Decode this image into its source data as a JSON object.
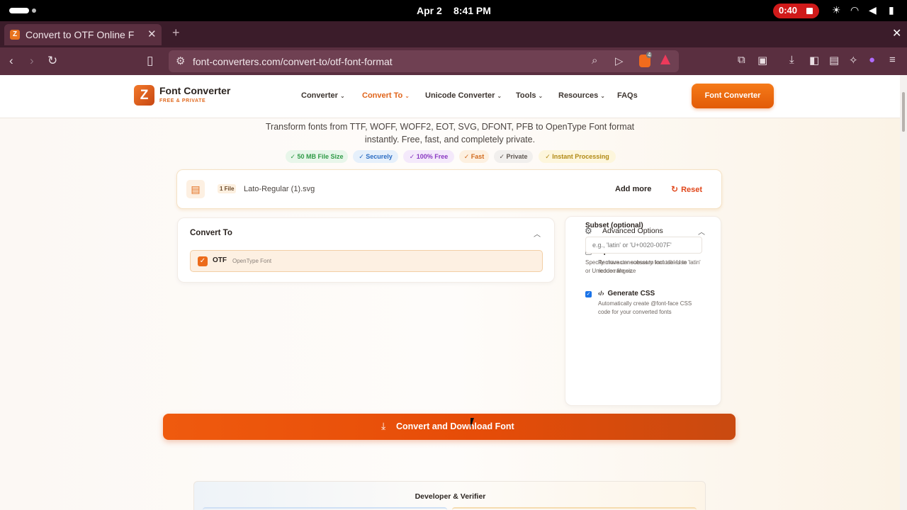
{
  "status_bar": {
    "date": "Apr 2",
    "time": "8:41 PM",
    "recording": "0:40"
  },
  "browser": {
    "tab_title": "Convert to OTF Online F",
    "favicon": "Z",
    "url": "font-converters.com/convert-to/otf-font-format",
    "brave_badge": "4"
  },
  "nav": {
    "logo_mark": "Z",
    "brand": "Font Converter",
    "tagline": "FREE & PRIVATE",
    "items": [
      {
        "label": "Converter"
      },
      {
        "label": "Convert To"
      },
      {
        "label": "Unicode Converter"
      },
      {
        "label": "Tools"
      },
      {
        "label": "Resources"
      },
      {
        "label": "FAQs"
      }
    ],
    "cta": "Font Converter",
    "accent": "#e0641a"
  },
  "hero": {
    "line1": "Transform fonts from TTF, WOFF, WOFF2, EOT, SVG, DFONT, PFB to OpenType Font format",
    "line2": "instantly. Free, fast, and completely private.",
    "badges": [
      "50 MB File Size",
      "Securely",
      "100% Free",
      "Fast",
      "Private",
      "Instant Processing"
    ]
  },
  "file_card": {
    "count": "1 File",
    "filename": "Lato-Regular (1).svg",
    "add_more": "Add more",
    "reset": "Reset"
  },
  "convert_to": {
    "title": "Convert To",
    "format": "OTF",
    "format_desc": "OpenType Font"
  },
  "advanced": {
    "title": "Advanced Options",
    "optimize_title": "Optimize for web",
    "optimize_desc": "Remove unnecessary font tables to reduce file size",
    "optimize_checked": false,
    "subset_label": "Subset (optional)",
    "subset_placeholder": "e.g., 'latin' or 'U+0020-007F'",
    "subset_help": "Specify character subset to include. Use 'latin' or Unicode ranges.",
    "css_title": "Generate CSS",
    "css_desc": "Automatically create @font-face CSS code for your converted fonts",
    "css_checked": true
  },
  "action": {
    "label": "Convert and Download Font"
  },
  "developer": {
    "title": "Developer & Verifier"
  }
}
